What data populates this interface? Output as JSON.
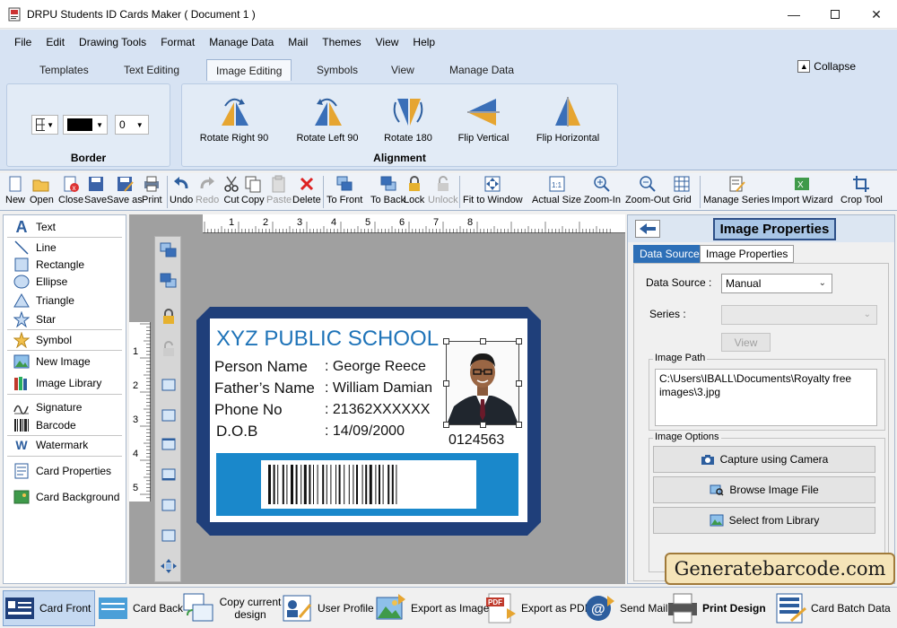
{
  "window": {
    "title": "DRPU Students ID Cards Maker ( Document 1 )"
  },
  "menu": [
    "File",
    "Edit",
    "Drawing Tools",
    "Format",
    "Manage Data",
    "Mail",
    "Themes",
    "View",
    "Help"
  ],
  "ribbon_tabs": [
    "Templates",
    "Text Editing",
    "Image Editing",
    "Symbols",
    "View",
    "Manage Data"
  ],
  "active_ribbon_tab": "Image Editing",
  "collapse_label": "Collapse",
  "ribbon": {
    "border_group": {
      "label": "Border",
      "width_value": "0",
      "color": "#000000"
    },
    "alignment_group": {
      "label": "Alignment",
      "buttons": [
        "Rotate Right 90",
        "Rotate Left 90",
        "Rotate 180",
        "Flip Vertical",
        "Flip Horizontal"
      ]
    }
  },
  "toolbar": [
    {
      "label": "New",
      "enabled": true
    },
    {
      "label": "Open",
      "enabled": true
    },
    {
      "label": "Close",
      "enabled": true
    },
    {
      "label": "Save",
      "enabled": true
    },
    {
      "label": "Save as",
      "enabled": true
    },
    {
      "label": "Print",
      "enabled": true
    },
    {
      "label": "Undo",
      "enabled": true
    },
    {
      "label": "Redo",
      "enabled": false
    },
    {
      "label": "Cut",
      "enabled": true
    },
    {
      "label": "Copy",
      "enabled": true
    },
    {
      "label": "Paste",
      "enabled": false
    },
    {
      "label": "Delete",
      "enabled": true
    },
    {
      "label": "To Front",
      "enabled": true
    },
    {
      "label": "To Back",
      "enabled": true
    },
    {
      "label": "Lock",
      "enabled": true
    },
    {
      "label": "Unlock",
      "enabled": false
    },
    {
      "label": "Fit to Window",
      "enabled": true
    },
    {
      "label": "Actual Size",
      "enabled": true
    },
    {
      "label": "Zoom-In",
      "enabled": true
    },
    {
      "label": "Zoom-Out",
      "enabled": true
    },
    {
      "label": "Grid",
      "enabled": true
    },
    {
      "label": "Manage Series",
      "enabled": true
    },
    {
      "label": "Import Wizard",
      "enabled": true
    },
    {
      "label": "Crop Tool",
      "enabled": true
    }
  ],
  "drawing_tools": [
    "Text",
    "Line",
    "Rectangle",
    "Ellipse",
    "Triangle",
    "Star",
    "Symbol",
    "New Image",
    "Image Library",
    "Signature",
    "Barcode",
    "Watermark",
    "Card Properties",
    "Card Background"
  ],
  "ruler": {
    "h_numbers": [
      "1",
      "2",
      "3",
      "4",
      "5",
      "6",
      "7",
      "8"
    ],
    "v_numbers": [
      "1",
      "2",
      "3",
      "4",
      "5"
    ]
  },
  "card": {
    "school": "XYZ PUBLIC SCHOOL",
    "fields": [
      {
        "label": "Person Name",
        "value": ": George Reece"
      },
      {
        "label": "Father’s Name",
        "value": ": William Damian"
      },
      {
        "label": "Phone No",
        "value": ": 21362XXXXXX"
      },
      {
        "label": "D.O.B",
        "value": ": 14/09/2000"
      }
    ],
    "id_number": "0124563",
    "colors": {
      "frame": "#1f3f7a",
      "title": "#1e73b8",
      "band": "#1a88cb"
    }
  },
  "right_panel": {
    "title": "Image Properties",
    "tabs": [
      "Data Source",
      "Image Properties"
    ],
    "active_tab": "Data Source",
    "data_source_label": "Data Source :",
    "data_source_value": "Manual",
    "series_label": "Series :",
    "view_button": "View",
    "image_path_label": "Image Path",
    "image_path_value": "C:\\Users\\IBALL\\Documents\\Royalty free images\\3.jpg",
    "image_options_label": "Image Options",
    "buttons": [
      "Capture using Camera",
      "Browse Image File",
      "Select from Library"
    ]
  },
  "logo_text": "Generatebarcode.com",
  "bottom_bar": [
    "Card Front",
    "Card Back",
    "Copy current design",
    "User Profile",
    "Export as Image",
    "Export as PDF",
    "Send Mail",
    "Print Design",
    "Card Batch Data"
  ],
  "active_bottom": "Card Front"
}
